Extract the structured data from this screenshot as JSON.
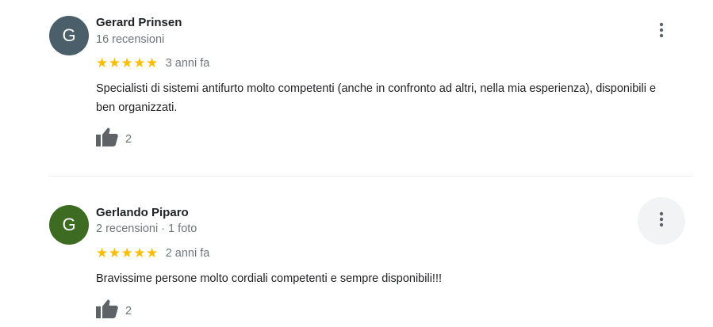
{
  "colors": {
    "avatar_1": "#4a5f6a",
    "avatar_2": "#3d6b22",
    "star": "#fbbc04",
    "secondary_text": "#70757a"
  },
  "reviews": [
    {
      "avatar_letter": "G",
      "name": "Gerard Prinsen",
      "meta": "16 recensioni",
      "stars": "★★★★★",
      "rating": 5,
      "date": "3 anni fa",
      "text": "Specialisti di sistemi antifurto molto competenti (anche in confronto ad altri, nella mia esperienza), disponibili e ben organizzati.",
      "likes": "2",
      "like_icon": "thumbs-up-icon",
      "menu_icon": "more-vert-icon"
    },
    {
      "avatar_letter": "G",
      "name": "Gerlando Piparo",
      "meta": "2 recensioni · 1 foto",
      "stars": "★★★★★",
      "rating": 5,
      "date": "2 anni fa",
      "text": "Bravissime persone molto cordiali competenti e sempre disponibili!!!",
      "likes": "2",
      "like_icon": "thumbs-up-icon",
      "menu_icon": "more-vert-icon"
    }
  ]
}
